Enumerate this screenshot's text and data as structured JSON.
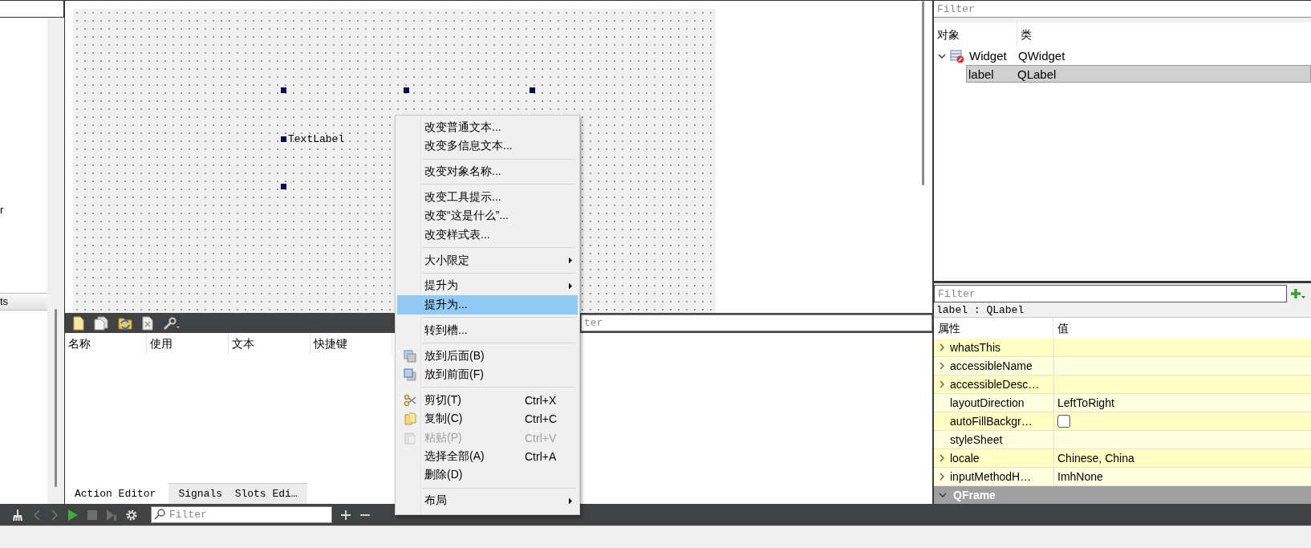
{
  "left_panel": {
    "text": "r",
    "section_header": "ts"
  },
  "form": {
    "label": {
      "text": "TextLabel",
      "selected": true
    }
  },
  "action_editor": {
    "filter": {
      "placeholder": "ter"
    },
    "columns": [
      "名称",
      "使用",
      "文本",
      "快捷键"
    ],
    "tabs": [
      {
        "label": "Action Editor",
        "selected": true
      },
      {
        "label": "Signals  Slots Edi…",
        "selected": false
      }
    ]
  },
  "context_menu": {
    "items": [
      {
        "kind": "action",
        "label": "改变普通文本...",
        "submenu": false,
        "disabled": false,
        "selected": false
      },
      {
        "kind": "action",
        "label": "改变多信息文本...",
        "submenu": false,
        "disabled": false,
        "selected": false
      },
      {
        "kind": "separator"
      },
      {
        "kind": "action",
        "label": "改变对象名称...",
        "submenu": false,
        "disabled": false,
        "selected": false
      },
      {
        "kind": "separator"
      },
      {
        "kind": "action",
        "label": "改变工具提示...",
        "submenu": false,
        "disabled": false,
        "selected": false
      },
      {
        "kind": "action",
        "label": "改变“这是什么”...",
        "submenu": false,
        "disabled": false,
        "selected": false
      },
      {
        "kind": "action",
        "label": "改变样式表...",
        "submenu": false,
        "disabled": false,
        "selected": false
      },
      {
        "kind": "separator"
      },
      {
        "kind": "action",
        "label": "大小限定",
        "submenu": true,
        "disabled": false,
        "selected": false
      },
      {
        "kind": "separator"
      },
      {
        "kind": "action",
        "label": "提升为",
        "submenu": true,
        "disabled": false,
        "selected": false
      },
      {
        "kind": "action",
        "label": "提升为...",
        "submenu": false,
        "disabled": false,
        "selected": true
      },
      {
        "kind": "separator"
      },
      {
        "kind": "action",
        "label": "转到槽...",
        "submenu": false,
        "disabled": false,
        "selected": false
      },
      {
        "kind": "separator"
      },
      {
        "kind": "action",
        "label": "放到后面(B)",
        "submenu": false,
        "disabled": false,
        "selected": false
      },
      {
        "kind": "action",
        "label": "放到前面(F)",
        "submenu": false,
        "disabled": false,
        "selected": false
      },
      {
        "kind": "separator"
      },
      {
        "kind": "action",
        "label": "剪切(T)",
        "shortcut": "Ctrl+X",
        "submenu": false,
        "disabled": false,
        "selected": false
      },
      {
        "kind": "action",
        "label": "复制(C)",
        "shortcut": "Ctrl+C",
        "submenu": false,
        "disabled": false,
        "selected": false
      },
      {
        "kind": "action",
        "label": "粘贴(P)",
        "shortcut": "Ctrl+V",
        "submenu": false,
        "disabled": true,
        "selected": false
      },
      {
        "kind": "action",
        "label": "选择全部(A)",
        "shortcut": "Ctrl+A",
        "submenu": false,
        "disabled": false,
        "selected": false
      },
      {
        "kind": "action",
        "label": "删除(D)",
        "submenu": false,
        "disabled": false,
        "selected": false
      },
      {
        "kind": "separator"
      },
      {
        "kind": "action",
        "label": "布局",
        "submenu": true,
        "disabled": false,
        "selected": false
      }
    ]
  },
  "object_inspector": {
    "filter": {
      "placeholder": "Filter"
    },
    "columns": [
      "对象",
      "类"
    ],
    "tree": [
      {
        "name": "Widget",
        "class": "QWidget",
        "expanded": true,
        "selected": false,
        "children": [
          {
            "name": "label",
            "class": "QLabel",
            "selected": true
          }
        ]
      }
    ]
  },
  "property_editor": {
    "filter": {
      "placeholder": "Filter"
    },
    "object_caption": "label : QLabel",
    "columns": [
      "属性",
      "值"
    ],
    "rows": [
      {
        "kind": "text",
        "name": "whatsThis",
        "expandable": true
      },
      {
        "kind": "text",
        "name": "accessibleName",
        "expandable": true
      },
      {
        "kind": "text",
        "name": "accessibleDesc…",
        "expandable": true
      },
      {
        "kind": "text",
        "name": "layoutDirection",
        "expandable": false,
        "value": "LeftToRight"
      },
      {
        "kind": "checkbox",
        "name": "autoFillBackgr…",
        "expandable": false,
        "checked": false
      },
      {
        "kind": "text",
        "name": "styleSheet",
        "expandable": false
      },
      {
        "kind": "text",
        "name": "locale",
        "expandable": true,
        "value": "Chinese, China"
      },
      {
        "kind": "text",
        "name": "inputMethodH…",
        "expandable": true,
        "value": "ImhNone"
      },
      {
        "kind": "group",
        "name": "QFrame",
        "expanded": true
      }
    ]
  },
  "bottom_toolbar": {
    "filter": {
      "placeholder": "Filter"
    }
  }
}
